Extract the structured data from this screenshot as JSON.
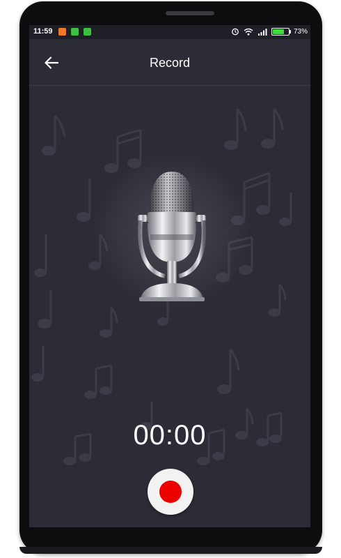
{
  "status_bar": {
    "time": "11:59",
    "battery_text": "73%",
    "battery_level": 0.73,
    "icons": [
      "bug-icon",
      "sim-icon",
      "android-icon",
      "alarm-icon",
      "wifi-icon",
      "signal-icon",
      "battery-icon"
    ]
  },
  "app_bar": {
    "title": "Record",
    "back_icon": "arrow-left-icon"
  },
  "recorder": {
    "timer": "00:00",
    "record_icon": "record-icon",
    "mic_image": "microphone-icon"
  },
  "colors": {
    "background": "#2c2c37",
    "status_bar": "#1f1f27",
    "record_red": "#ee0000",
    "record_button": "#f2f2f2"
  }
}
